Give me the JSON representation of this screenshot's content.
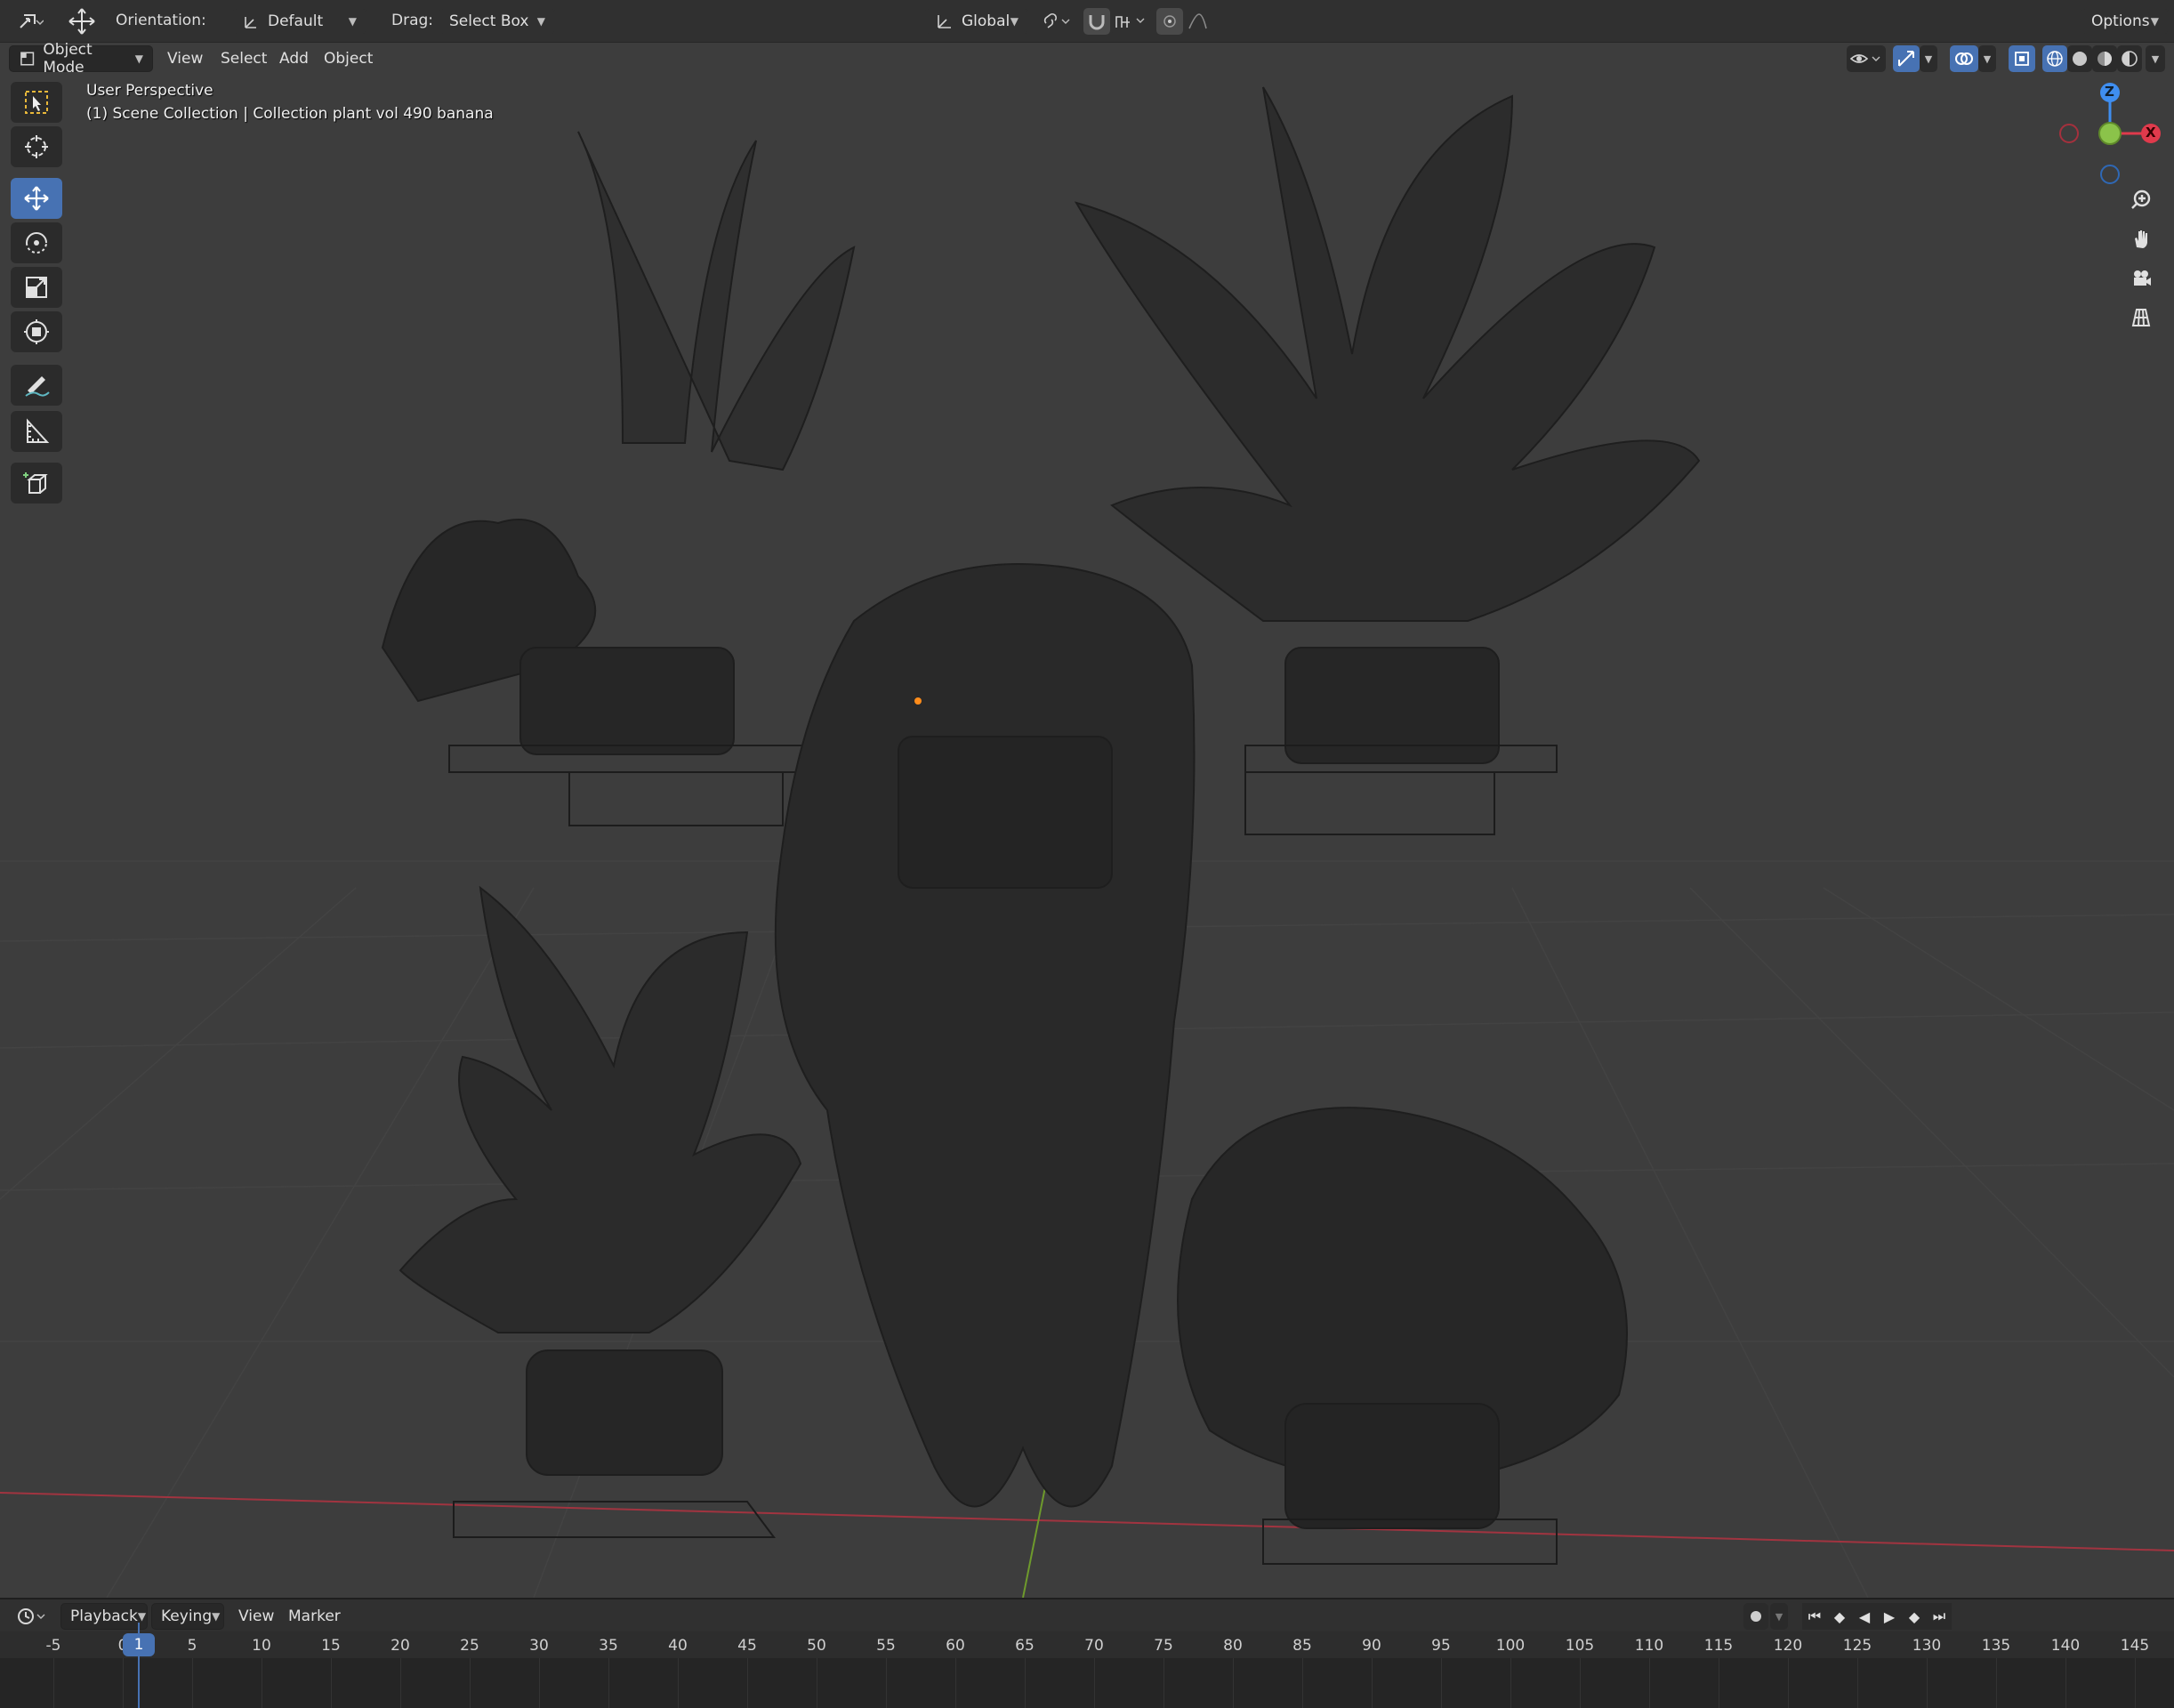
{
  "header": {
    "orientation_label": "Orientation:",
    "orientation_value": "Default",
    "drag_label": "Drag:",
    "drag_value": "Select Box",
    "transform_orientation": "Global",
    "options_label": "Options"
  },
  "header2": {
    "mode": "Object Mode",
    "menus": [
      "View",
      "Select",
      "Add",
      "Object"
    ]
  },
  "viewport": {
    "perspective_label": "User Perspective",
    "collection_label": "(1) Scene Collection | Collection plant vol 490 banana"
  },
  "gizmo": {
    "z": "Z",
    "x": "X"
  },
  "toolbar": {
    "tools": [
      "select-box",
      "cursor",
      "move",
      "rotate",
      "scale",
      "transform",
      "annotate",
      "measure",
      "add-cube"
    ],
    "active": "move"
  },
  "timeline": {
    "menus": [
      "Playback",
      "Keying",
      "View",
      "Marker"
    ],
    "current_frame": "1",
    "ticks": [
      "-5",
      "0",
      "5",
      "10",
      "15",
      "20",
      "25",
      "30",
      "35",
      "40",
      "45",
      "50",
      "55",
      "60",
      "65",
      "70",
      "75",
      "80",
      "85",
      "90",
      "95",
      "100",
      "105",
      "110",
      "115",
      "120",
      "125",
      "130",
      "135",
      "140",
      "145"
    ]
  },
  "colors": {
    "accent": "#4772b3",
    "x_axis": "#e03a4c",
    "y_axis": "#8bc34a",
    "z_axis": "#3f8ef0",
    "background": "#3d3d3d"
  }
}
